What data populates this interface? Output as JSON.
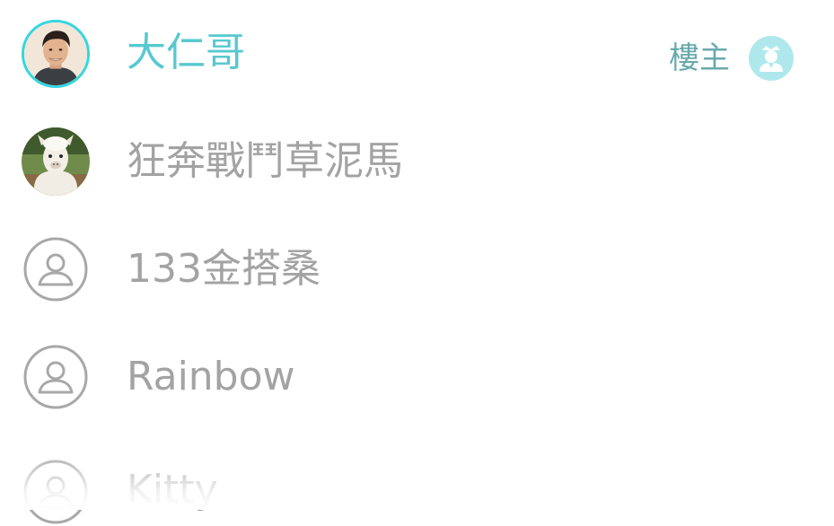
{
  "members": [
    {
      "name": "大仁哥",
      "avatar": "photo-avatar-man",
      "is_owner": true
    },
    {
      "name": "狂奔戰鬥草泥馬",
      "avatar": "photo-avatar-alpaca",
      "is_owner": false
    },
    {
      "name": "133金搭桑",
      "avatar": "default-person-icon",
      "is_owner": false
    },
    {
      "name": "Rainbow",
      "avatar": "default-person-icon",
      "is_owner": false
    },
    {
      "name": "Kitty",
      "avatar": "default-person-icon",
      "is_owner": false
    }
  ],
  "owner_tag": {
    "label": "樓主",
    "icon": "crown-person-icon"
  },
  "colors": {
    "owner_accent": "#35d6df",
    "owner_name": "#56c9cf",
    "owner_tag_text": "#6aa9ad",
    "badge_bg": "#aee8ec",
    "member_name": "#a3a3a3",
    "default_icon_stroke": "#a8a8a8"
  }
}
